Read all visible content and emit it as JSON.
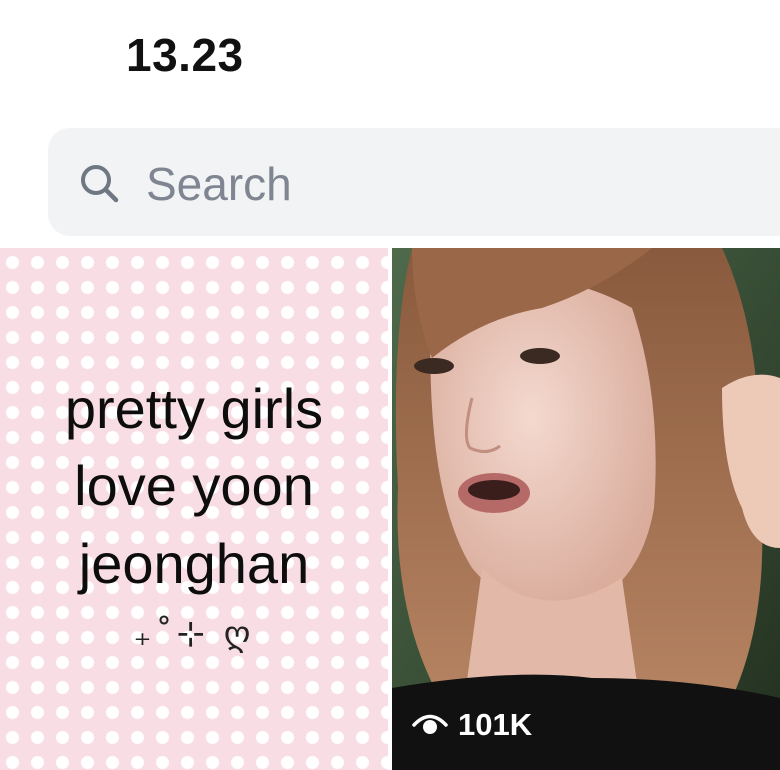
{
  "status_bar": {
    "time": "13.23"
  },
  "search": {
    "placeholder": "Search",
    "value": ""
  },
  "grid": {
    "tiles": [
      {
        "type": "image",
        "lines": [
          "pretty girls",
          "love yoon",
          "jeonghan"
        ],
        "decoration": "₊˚⊹ ღ",
        "bg_color": "#f8dde4"
      },
      {
        "type": "video",
        "views": "101K",
        "icon": "eye-icon"
      }
    ]
  }
}
